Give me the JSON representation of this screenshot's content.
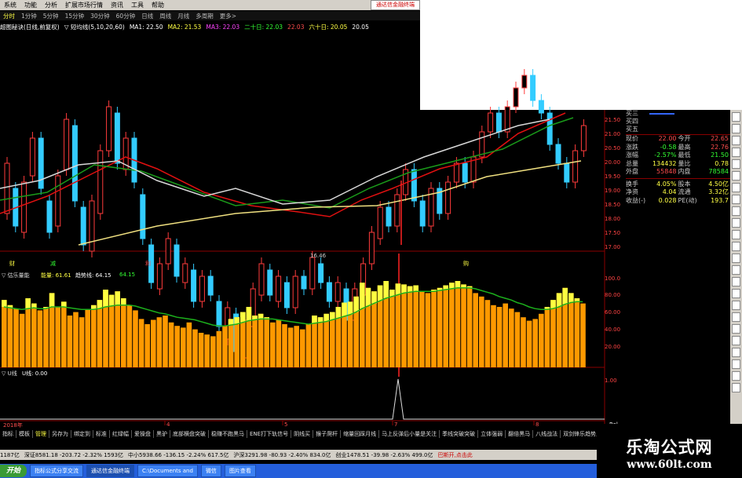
{
  "menu": {
    "items": [
      "系统",
      "功能",
      "分析",
      "扩展市场行情",
      "资讯",
      "工具",
      "帮助"
    ],
    "ad_text": "通达信金融终端"
  },
  "periods": [
    "分时",
    "1分钟",
    "5分钟",
    "15分钟",
    "30分钟",
    "60分钟",
    "日线",
    "周线",
    "月线",
    "多周期",
    "更多>"
  ],
  "ma_line": {
    "prefix": "超图秘诀(日线,前复权)",
    "ma_label": "▽ 短均线(5,10,20,60)",
    "ma1": "MA1: 22.50",
    "ma2": "MA2: 21.53",
    "ma3": "MA3: 22.03",
    "ma_twenty": "二十日: 22.03",
    "ma_twenty2": "22.03",
    "ma_sixty": "六十日: 20.05",
    "ma_sixty2": "20.05"
  },
  "price_axis": [
    "21.50",
    "21.00",
    "20.50",
    "20.00",
    "19.50",
    "19.00",
    "18.50",
    "18.00",
    "17.50",
    "17.00"
  ],
  "low_marker": "16.46",
  "signals": {
    "s1": "财",
    "s2": "减",
    "s3": "利",
    "s4": "购"
  },
  "ind1": {
    "label": "▽ 估乐量能",
    "energy": "能量: 61.61",
    "trend": "趋势线: 64.15",
    "val": "64.15",
    "axis": [
      "100.0",
      "80.00",
      "60.00",
      "40.00",
      "20.00"
    ],
    "bars": [
      78,
      72,
      68,
      62,
      80,
      74,
      66,
      70,
      86,
      70,
      76,
      60,
      64,
      58,
      67,
      72,
      78,
      90,
      84,
      88,
      80,
      72,
      66,
      56,
      50,
      55,
      58,
      60,
      52,
      48,
      46,
      52,
      44,
      40,
      38,
      36,
      42,
      48,
      56,
      58,
      64,
      70,
      60,
      62,
      58,
      52,
      55,
      50,
      46,
      48,
      44,
      50,
      60,
      58,
      62,
      64,
      70,
      75,
      76,
      82,
      98,
      92,
      88,
      95,
      100,
      90,
      97,
      96,
      94,
      95,
      88,
      86,
      90,
      92,
      95,
      98,
      100,
      96,
      94,
      86,
      82,
      78,
      72,
      70,
      74,
      68,
      64,
      58,
      54,
      56,
      62,
      70,
      78,
      86,
      92,
      86,
      80,
      74
    ],
    "trend_line": [
      70,
      69,
      68,
      67,
      68,
      69,
      68,
      68,
      70,
      70,
      70,
      69,
      68,
      67,
      67,
      67,
      68,
      70,
      71,
      72,
      72,
      72,
      71,
      69,
      67,
      65,
      63,
      62,
      60,
      58,
      57,
      56,
      55,
      53,
      51,
      49,
      48,
      48,
      49,
      50,
      52,
      54,
      55,
      56,
      56,
      56,
      55,
      54,
      53,
      52,
      51,
      50,
      51,
      52,
      53,
      55,
      57,
      59,
      61,
      64,
      68,
      71,
      74,
      77,
      80,
      82,
      84,
      86,
      87,
      88,
      88,
      88,
      88,
      89,
      90,
      91,
      92,
      92,
      92,
      91,
      89,
      87,
      85,
      82,
      80,
      78,
      75,
      73,
      70,
      68,
      67,
      67,
      68,
      70,
      73,
      75,
      76,
      76
    ]
  },
  "ind2": {
    "label": "▽ U线",
    "val": "U线: 0.00",
    "axis_top": "1.00"
  },
  "date_axis": {
    "d1": "2018年",
    "d2": "4",
    "d3": "5",
    "d4": "7",
    "d5": "8",
    "flag": "Rel"
  },
  "quote": {
    "asks": [
      "买三",
      "买四",
      "买五"
    ],
    "rows": [
      {
        "l1": "现价",
        "v1": "22.00",
        "l2": "今开",
        "v2": "22.65"
      },
      {
        "l1": "涨跌",
        "v1": "-0.58",
        "l2": "最高",
        "v2": "22.76"
      },
      {
        "l1": "涨幅",
        "v1": "-2.57%",
        "l2": "最低",
        "v2": "21.50"
      },
      {
        "l1": "总量",
        "v1": "134432",
        "l2": "量比",
        "v2": "0.78"
      },
      {
        "l1": "外盘",
        "v1": "55848",
        "l2": "内盘",
        "v2": "78584"
      }
    ],
    "rows2": [
      {
        "l1": "换手",
        "v1": "4.05%",
        "l2": "股本",
        "v2": "4.50亿"
      },
      {
        "l1": "净资",
        "v1": "4.04",
        "l2": "流通",
        "v2": "3.32亿"
      },
      {
        "l1": "收益(-)",
        "v1": "0.028",
        "l2": "PE(动)",
        "v2": "193.7"
      }
    ]
  },
  "strategy_tabs": [
    "指标",
    "模板",
    "管理",
    "另存为",
    "绑定到",
    "标准",
    "红绿幅",
    "爱操盘",
    "黑驴",
    "底部横盘突破",
    "稳赚不跑黑马",
    "ENE打下轨信号",
    "阴线买",
    "猴子爬杆",
    "缩量回踩月线",
    "马上反弹后小量是关注",
    "季线突破突破",
    "立体强弱",
    "翻倍黑马",
    "八线战法",
    "双剑锋乐趋势反弹二合一",
    "抄底量",
    "凸"
  ],
  "ticker": [
    "1187亿",
    "深证8581.18 -203.72 -2.32% 1593亿",
    "中小5938.66 -136.15 -2.24% 617.5亿",
    "沪深3291.98 -80.93 -2.40% 834.0亿",
    "创业1478.51 -39.98 -2.63% 499.0亿",
    "巴斯开,点击此"
  ],
  "taskbar": {
    "start": "开始",
    "items": [
      "指标公式分享交流",
      "通达信金融终端",
      "C:\\Documents and",
      "微信",
      "图片查看"
    ]
  },
  "watermark": {
    "line1": "乐淘公式网",
    "line2": "www.60lt.com"
  },
  "colors": {
    "up": "#ff3b3b",
    "down": "#3cf",
    "ma_red": "#e01010",
    "ma_green": "#1a9a1a",
    "ma_yellow": "#f0e080",
    "ma_white": "#d8d8d8",
    "vol": "#ff9900",
    "vol_top": "#ffff40"
  }
}
